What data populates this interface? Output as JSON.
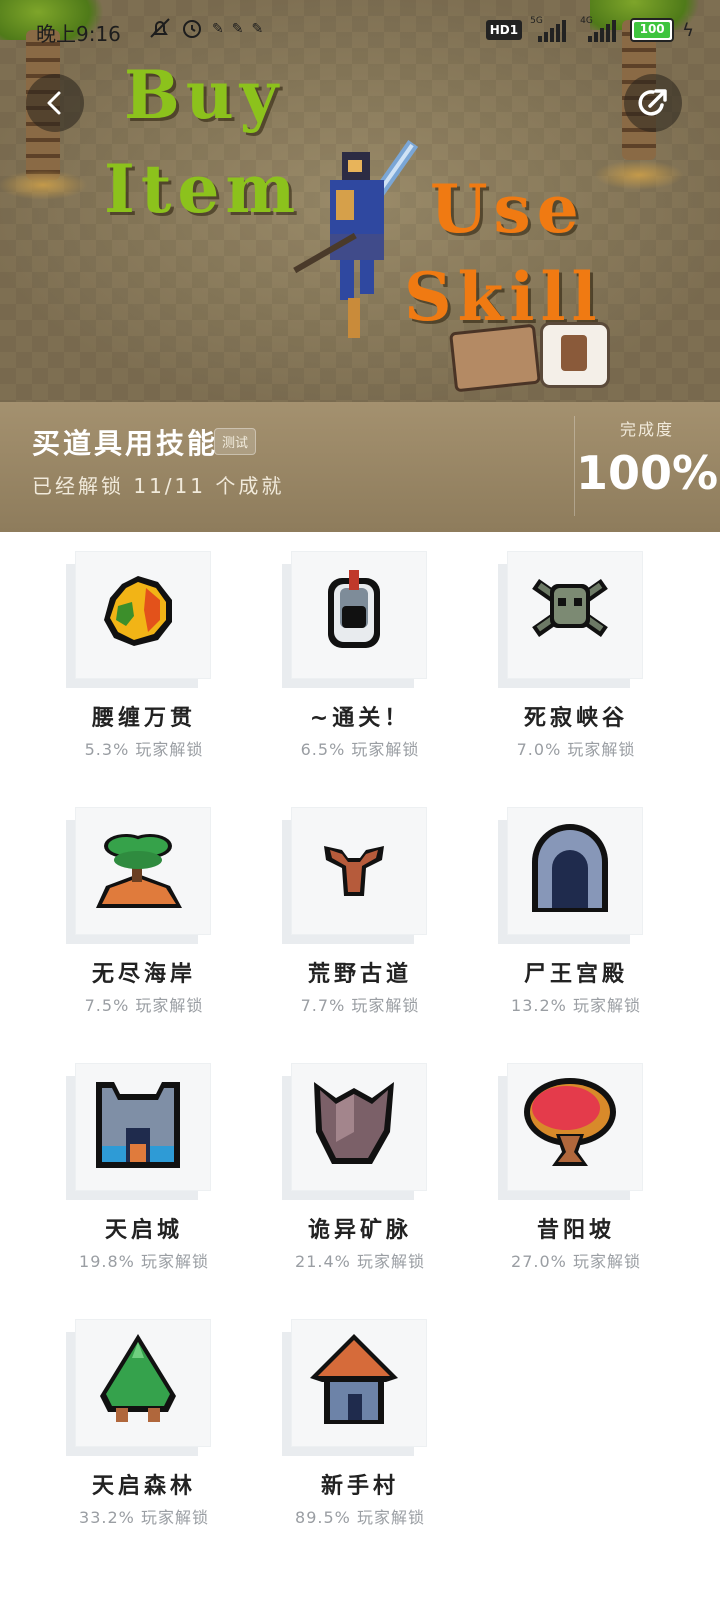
{
  "status_bar": {
    "time": "晚上9:16",
    "network_badge": "HD1",
    "signal1_label": "5G",
    "signal2_label": "4G",
    "battery": "100"
  },
  "banner": {
    "words": [
      "Buy",
      "Item",
      "Use",
      "Skill"
    ],
    "colors": {
      "green": "#8cc21c",
      "orange": "#f07a12"
    }
  },
  "header": {
    "game_name": "买道具用技能",
    "tag": "测试",
    "unlocked_text": "已经解锁 11/11 个成就",
    "completion_label": "完成度",
    "completion_value": "100%"
  },
  "achievements": [
    {
      "name": "腰缠万贯",
      "rate": "5.3% 玩家解锁",
      "icon": "gold-bag-icon"
    },
    {
      "name": "~通关！",
      "rate": "6.5% 玩家解锁",
      "icon": "knight-helmet-icon"
    },
    {
      "name": "死寂峡谷",
      "rate": "7.0% 玩家解锁",
      "icon": "skull-crossbones-icon"
    },
    {
      "name": "无尽海岸",
      "rate": "7.5% 玩家解锁",
      "icon": "palm-island-icon"
    },
    {
      "name": "荒野古道",
      "rate": "7.7% 玩家解锁",
      "icon": "dead-tree-icon"
    },
    {
      "name": "尸王宫殿",
      "rate": "13.2% 玩家解锁",
      "icon": "stone-arch-icon"
    },
    {
      "name": "天启城",
      "rate": "19.8% 玩家解锁",
      "icon": "castle-icon"
    },
    {
      "name": "诡异矿脉",
      "rate": "21.4% 玩家解锁",
      "icon": "crystal-rocks-icon"
    },
    {
      "name": "昔阳坡",
      "rate": "27.0% 玩家解锁",
      "icon": "red-tree-icon"
    },
    {
      "name": "天启森林",
      "rate": "33.2% 玩家解锁",
      "icon": "pine-tree-icon"
    },
    {
      "name": "新手村",
      "rate": "89.5% 玩家解锁",
      "icon": "village-hut-icon"
    }
  ]
}
